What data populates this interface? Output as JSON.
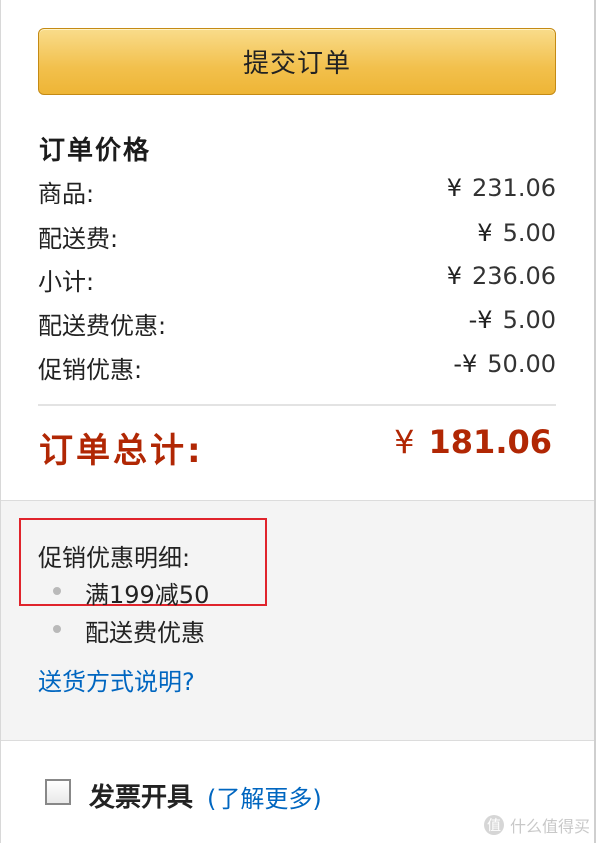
{
  "submit_button": {
    "label": "提交订单"
  },
  "summary": {
    "title": "订单价格",
    "rows": [
      {
        "label": "商品:",
        "currency": "¥",
        "amount": "231.06"
      },
      {
        "label": "配送费:",
        "currency": "¥",
        "amount": "5.00"
      },
      {
        "label": "小计:",
        "currency": "¥",
        "amount": "236.06"
      },
      {
        "label": "配送费优惠:",
        "currency": "-¥",
        "amount": "5.00"
      },
      {
        "label": "促销优惠:",
        "currency": "-¥",
        "amount": "50.00"
      }
    ],
    "total": {
      "label": "订单总计:",
      "currency": "¥",
      "amount": "181.06"
    }
  },
  "promotions": {
    "title": "促销优惠明细:",
    "items": [
      "满199减50",
      "配送费优惠"
    ],
    "shipping_link": "送货方式说明?"
  },
  "invoice": {
    "label": "发票开具",
    "learn_more": "(了解更多)"
  },
  "watermark": {
    "logo": "值",
    "text": "什么值得买"
  },
  "colors": {
    "total_red": "#b12704",
    "link_blue": "#0066c0",
    "button_gold": "#f2c04c",
    "highlight_red": "#e0242c"
  }
}
